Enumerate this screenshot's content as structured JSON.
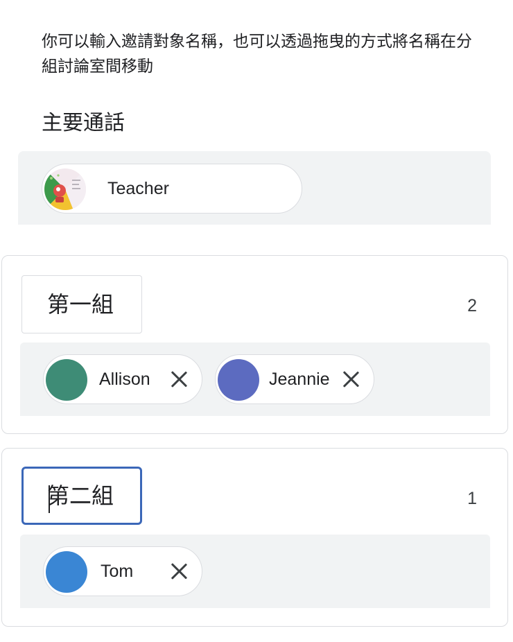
{
  "instructions": "你可以輸入邀請對象名稱，也可以透過拖曳的方式將名稱在分組討論室間移動",
  "main_call": {
    "title": "主要通話",
    "participants": [
      {
        "name": "Teacher",
        "avatar": "teacher-cartoon-avatar"
      }
    ]
  },
  "groups": [
    {
      "name": "第一組",
      "count": "2",
      "participants": [
        {
          "name": "Allison",
          "avatar_color": "#3e8c76"
        },
        {
          "name": "Jeannie",
          "avatar_color": "#5c6bc0"
        }
      ]
    },
    {
      "name": "第二組",
      "count": "1",
      "focused": true,
      "participants": [
        {
          "name": "Tom",
          "avatar_color": "#3a86d4"
        }
      ]
    }
  ],
  "icons": {
    "remove": "close-icon"
  }
}
